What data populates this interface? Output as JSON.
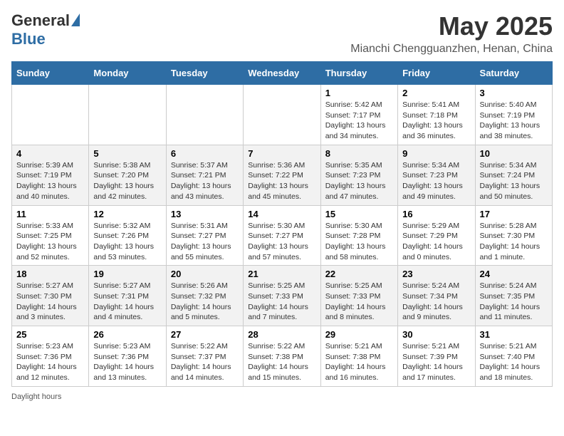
{
  "logo": {
    "general": "General",
    "blue": "Blue"
  },
  "title": "May 2025",
  "location": "Mianchi Chengguanzhen, Henan, China",
  "days_of_week": [
    "Sunday",
    "Monday",
    "Tuesday",
    "Wednesday",
    "Thursday",
    "Friday",
    "Saturday"
  ],
  "weeks": [
    [
      {
        "day": "",
        "info": ""
      },
      {
        "day": "",
        "info": ""
      },
      {
        "day": "",
        "info": ""
      },
      {
        "day": "",
        "info": ""
      },
      {
        "day": "1",
        "info": "Sunrise: 5:42 AM\nSunset: 7:17 PM\nDaylight: 13 hours\nand 34 minutes."
      },
      {
        "day": "2",
        "info": "Sunrise: 5:41 AM\nSunset: 7:18 PM\nDaylight: 13 hours\nand 36 minutes."
      },
      {
        "day": "3",
        "info": "Sunrise: 5:40 AM\nSunset: 7:19 PM\nDaylight: 13 hours\nand 38 minutes."
      }
    ],
    [
      {
        "day": "4",
        "info": "Sunrise: 5:39 AM\nSunset: 7:19 PM\nDaylight: 13 hours\nand 40 minutes."
      },
      {
        "day": "5",
        "info": "Sunrise: 5:38 AM\nSunset: 7:20 PM\nDaylight: 13 hours\nand 42 minutes."
      },
      {
        "day": "6",
        "info": "Sunrise: 5:37 AM\nSunset: 7:21 PM\nDaylight: 13 hours\nand 43 minutes."
      },
      {
        "day": "7",
        "info": "Sunrise: 5:36 AM\nSunset: 7:22 PM\nDaylight: 13 hours\nand 45 minutes."
      },
      {
        "day": "8",
        "info": "Sunrise: 5:35 AM\nSunset: 7:23 PM\nDaylight: 13 hours\nand 47 minutes."
      },
      {
        "day": "9",
        "info": "Sunrise: 5:34 AM\nSunset: 7:23 PM\nDaylight: 13 hours\nand 49 minutes."
      },
      {
        "day": "10",
        "info": "Sunrise: 5:34 AM\nSunset: 7:24 PM\nDaylight: 13 hours\nand 50 minutes."
      }
    ],
    [
      {
        "day": "11",
        "info": "Sunrise: 5:33 AM\nSunset: 7:25 PM\nDaylight: 13 hours\nand 52 minutes."
      },
      {
        "day": "12",
        "info": "Sunrise: 5:32 AM\nSunset: 7:26 PM\nDaylight: 13 hours\nand 53 minutes."
      },
      {
        "day": "13",
        "info": "Sunrise: 5:31 AM\nSunset: 7:27 PM\nDaylight: 13 hours\nand 55 minutes."
      },
      {
        "day": "14",
        "info": "Sunrise: 5:30 AM\nSunset: 7:27 PM\nDaylight: 13 hours\nand 57 minutes."
      },
      {
        "day": "15",
        "info": "Sunrise: 5:30 AM\nSunset: 7:28 PM\nDaylight: 13 hours\nand 58 minutes."
      },
      {
        "day": "16",
        "info": "Sunrise: 5:29 AM\nSunset: 7:29 PM\nDaylight: 14 hours\nand 0 minutes."
      },
      {
        "day": "17",
        "info": "Sunrise: 5:28 AM\nSunset: 7:30 PM\nDaylight: 14 hours\nand 1 minute."
      }
    ],
    [
      {
        "day": "18",
        "info": "Sunrise: 5:27 AM\nSunset: 7:30 PM\nDaylight: 14 hours\nand 3 minutes."
      },
      {
        "day": "19",
        "info": "Sunrise: 5:27 AM\nSunset: 7:31 PM\nDaylight: 14 hours\nand 4 minutes."
      },
      {
        "day": "20",
        "info": "Sunrise: 5:26 AM\nSunset: 7:32 PM\nDaylight: 14 hours\nand 5 minutes."
      },
      {
        "day": "21",
        "info": "Sunrise: 5:25 AM\nSunset: 7:33 PM\nDaylight: 14 hours\nand 7 minutes."
      },
      {
        "day": "22",
        "info": "Sunrise: 5:25 AM\nSunset: 7:33 PM\nDaylight: 14 hours\nand 8 minutes."
      },
      {
        "day": "23",
        "info": "Sunrise: 5:24 AM\nSunset: 7:34 PM\nDaylight: 14 hours\nand 9 minutes."
      },
      {
        "day": "24",
        "info": "Sunrise: 5:24 AM\nSunset: 7:35 PM\nDaylight: 14 hours\nand 11 minutes."
      }
    ],
    [
      {
        "day": "25",
        "info": "Sunrise: 5:23 AM\nSunset: 7:36 PM\nDaylight: 14 hours\nand 12 minutes."
      },
      {
        "day": "26",
        "info": "Sunrise: 5:23 AM\nSunset: 7:36 PM\nDaylight: 14 hours\nand 13 minutes."
      },
      {
        "day": "27",
        "info": "Sunrise: 5:22 AM\nSunset: 7:37 PM\nDaylight: 14 hours\nand 14 minutes."
      },
      {
        "day": "28",
        "info": "Sunrise: 5:22 AM\nSunset: 7:38 PM\nDaylight: 14 hours\nand 15 minutes."
      },
      {
        "day": "29",
        "info": "Sunrise: 5:21 AM\nSunset: 7:38 PM\nDaylight: 14 hours\nand 16 minutes."
      },
      {
        "day": "30",
        "info": "Sunrise: 5:21 AM\nSunset: 7:39 PM\nDaylight: 14 hours\nand 17 minutes."
      },
      {
        "day": "31",
        "info": "Sunrise: 5:21 AM\nSunset: 7:40 PM\nDaylight: 14 hours\nand 18 minutes."
      }
    ]
  ],
  "footer": {
    "daylight_label": "Daylight hours"
  }
}
